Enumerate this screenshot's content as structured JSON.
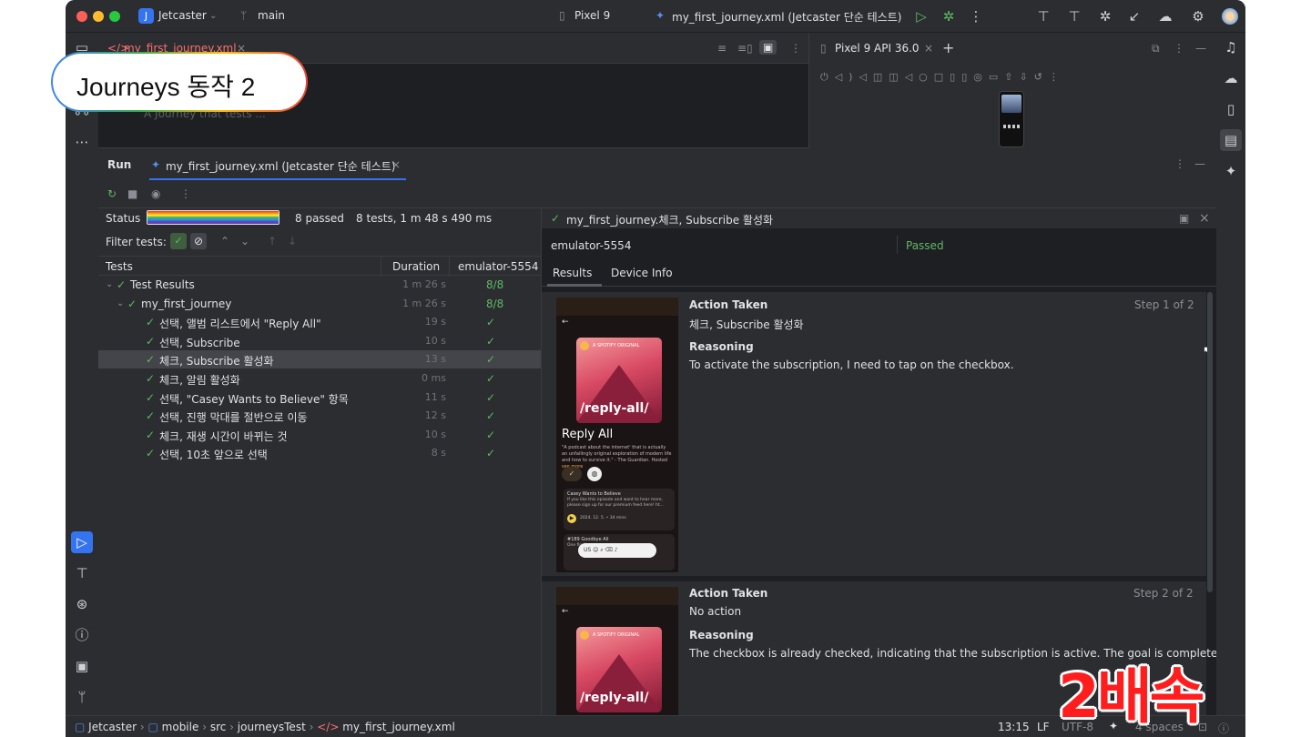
{
  "titlebar": {
    "project_initial": "J",
    "project": "Jetcaster",
    "branch": "main",
    "device": "Pixel 9",
    "run_config": "my_first_journey.xml (Jetcaster 단순 테스트)"
  },
  "editor": {
    "tab": "my_first_journey.xml",
    "hint": "A Journey that tests ..."
  },
  "overlay_badge": "Journeys 동작 2",
  "speed_badge": "2배속",
  "emulator": {
    "tab": "Pixel 9 API 36.0"
  },
  "run": {
    "title": "Run",
    "tab": "my_first_journey.xml (Jetcaster 단순 테스트)",
    "status_label": "Status",
    "passed": "8 passed",
    "summary": "8 tests, 1 m 48 s 490 ms",
    "progress": 1.0,
    "filter_label": "Filter tests:",
    "headers": {
      "tests": "Tests",
      "duration": "Duration",
      "device": "emulator-5554"
    },
    "rows": [
      {
        "name": "Test Results",
        "duration": "1 m 26 s",
        "result": "8/8",
        "level": 0
      },
      {
        "name": "my_first_journey",
        "duration": "1 m 26 s",
        "result": "8/8",
        "level": 1
      },
      {
        "name": "선택, 앨범 리스트에서 \"Reply All\"",
        "duration": "19 s",
        "result": "✓",
        "level": 2
      },
      {
        "name": "선택, Subscribe",
        "duration": "10 s",
        "result": "✓",
        "level": 2
      },
      {
        "name": "체크, Subscribe 활성화",
        "duration": "13 s",
        "result": "✓",
        "level": 2,
        "selected": true
      },
      {
        "name": "체크, 알림 활성화",
        "duration": "0 ms",
        "result": "✓",
        "level": 2
      },
      {
        "name": "선택, \"Casey Wants to Believe\" 항목",
        "duration": "11 s",
        "result": "✓",
        "level": 2
      },
      {
        "name": "선택, 진행 막대를 절반으로 이동",
        "duration": "12 s",
        "result": "✓",
        "level": 2
      },
      {
        "name": "체크, 재생 시간이 바뀌는 것",
        "duration": "10 s",
        "result": "✓",
        "level": 2
      },
      {
        "name": "선택, 10초 앞으로 선택",
        "duration": "8 s",
        "result": "✓",
        "level": 2
      }
    ]
  },
  "detail": {
    "title": "my_first_journey.체크, Subscribe 활성화",
    "device": "emulator-5554",
    "status": "Passed",
    "tabs": [
      "Results",
      "Device Info"
    ],
    "steps": [
      {
        "action_label": "Action Taken",
        "action": "체크, Subscribe 활성화",
        "step": "Step 1 of 2",
        "reasoning_label": "Reasoning",
        "reasoning": "To activate the subscription, I need to tap on the checkbox."
      },
      {
        "action_label": "Action Taken",
        "action": "No action",
        "step": "Step 2 of 2",
        "reasoning_label": "Reasoning",
        "reasoning": "The checkbox is already checked, indicating that the subscription is active. The goal is complete."
      }
    ]
  },
  "phone_screen": {
    "kicker": "A SPOTIFY ORIGINAL",
    "art_title": "/reply-all/",
    "podcast": "Reply All",
    "description": "\"A podcast about the internet' that is actually an unfailingly original exploration of modern life and how to survive it.\" - The Guardian. Hosted",
    "see_more": "see more",
    "episode1_title": "Casey Wants to Believe",
    "episode1_text": "If you like this episode and want to hear more, please sign up for our premium feed here! ht...",
    "episode1_meta": "2024. 12. 5. • 34 mins",
    "episode2_title": "#189 Goodbye All",
    "episode2_text": "One final...",
    "keyboard_lang": "US"
  },
  "statusbar": {
    "crumbs": [
      "Jetcaster",
      "mobile",
      "src",
      "journeysTest",
      "my_first_journey.xml"
    ],
    "position": "13:15",
    "line_sep": "LF",
    "encoding": "UTF-8",
    "indent": "4 spaces"
  },
  "colors": {
    "accent": "#3574f0",
    "pass": "#5fb865",
    "panel": "#2b2d30",
    "editor": "#1e1f22"
  }
}
